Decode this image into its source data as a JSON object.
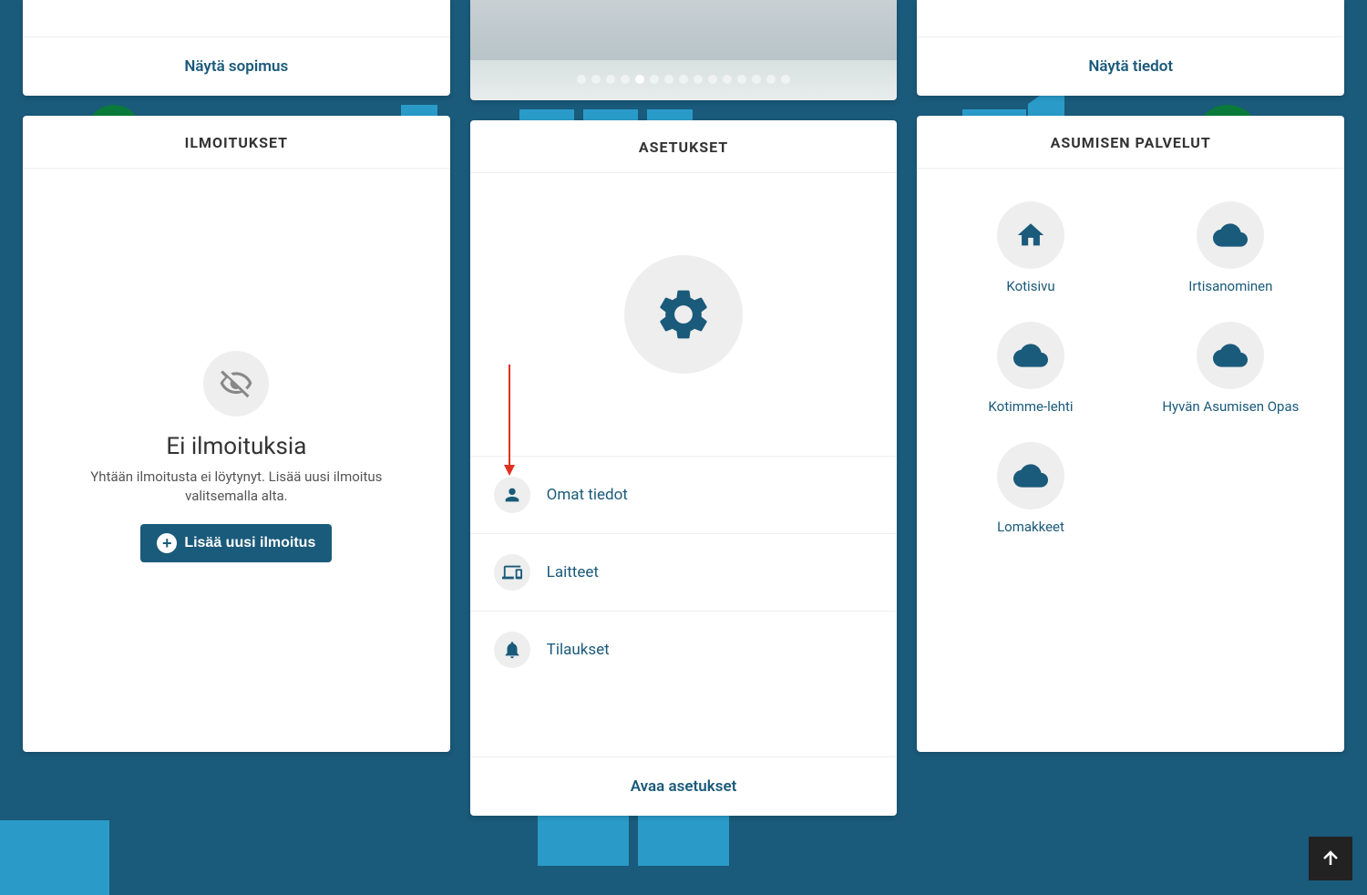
{
  "topRow": {
    "left": {
      "action": "Näytä sopimus"
    },
    "center": {
      "totalDots": 15,
      "activeDot": 4
    },
    "right": {
      "action": "Näytä tiedot"
    }
  },
  "notifications": {
    "header": "ILMOITUKSET",
    "emptyTitle": "Ei ilmoituksia",
    "emptySubtitle": "Yhtään ilmoitusta ei löytynyt. Lisää uusi ilmoitus valitsemalla alta.",
    "addButton": "Lisää uusi ilmoitus"
  },
  "settings": {
    "header": "ASETUKSET",
    "items": [
      {
        "icon": "person",
        "label": "Omat tiedot"
      },
      {
        "icon": "devices",
        "label": "Laitteet"
      },
      {
        "icon": "bell",
        "label": "Tilaukset"
      }
    ],
    "openAction": "Avaa asetukset"
  },
  "services": {
    "header": "ASUMISEN PALVELUT",
    "items": [
      {
        "icon": "home",
        "label": "Kotisivu"
      },
      {
        "icon": "cloud",
        "label": "Irtisanominen"
      },
      {
        "icon": "cloud",
        "label": "Kotimme-lehti"
      },
      {
        "icon": "cloud",
        "label": "Hyvän Asumisen Opas"
      },
      {
        "icon": "cloud",
        "label": "Lomakkeet"
      }
    ]
  }
}
